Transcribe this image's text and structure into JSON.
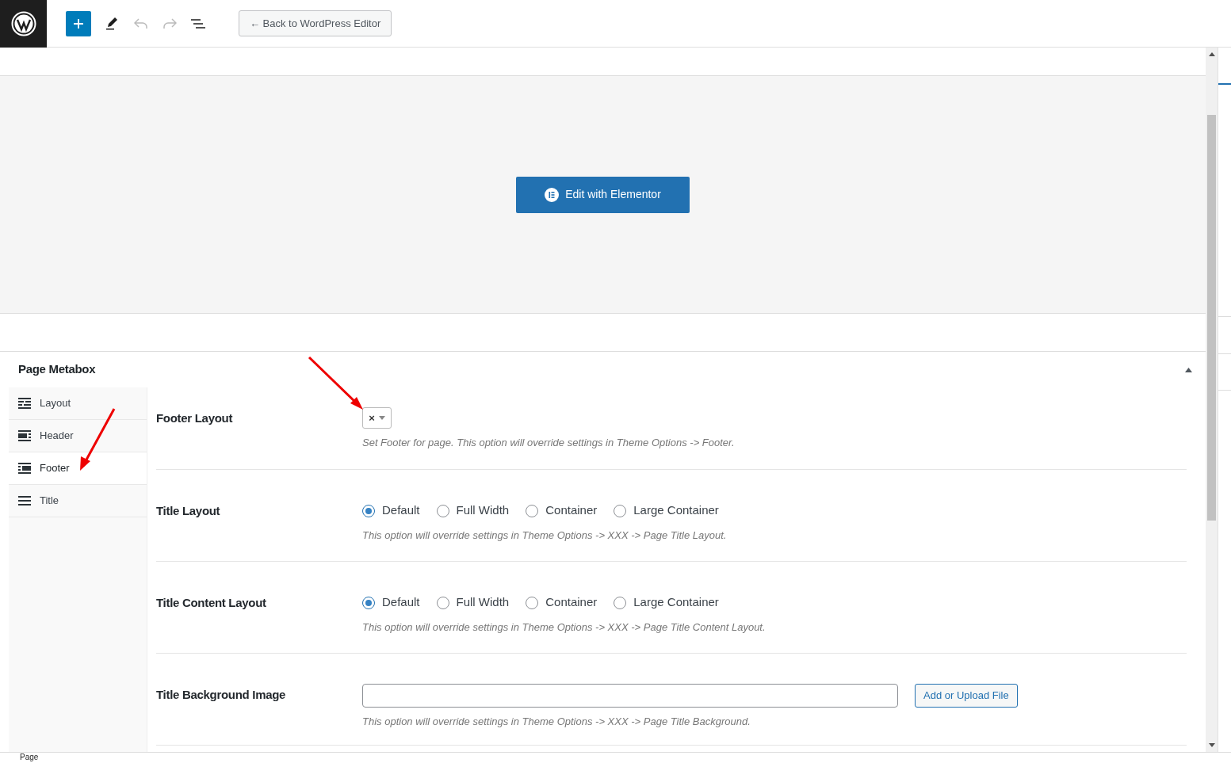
{
  "toolbar": {
    "back_button": "← Back to WordPress Editor",
    "undo_disabled": true,
    "redo_disabled": true
  },
  "canvas": {
    "button": "Edit with Elementor"
  },
  "metabox": {
    "title": "Page Metabox",
    "expanded": true,
    "tabs": [
      {
        "label": "Layout",
        "selected": false
      },
      {
        "label": "Header",
        "selected": false
      },
      {
        "label": "Footer",
        "selected": true
      },
      {
        "label": "Title",
        "selected": false
      }
    ],
    "fields": [
      {
        "kind": "select",
        "label": "Footer Layout",
        "value": "×",
        "help": "Set Footer for page. This option will override settings in Theme Options -> Footer."
      },
      {
        "kind": "radio",
        "label": "Title Layout",
        "options": [
          {
            "label": "Default",
            "selected": true
          },
          {
            "label": "Full Width",
            "selected": false
          },
          {
            "label": "Container",
            "selected": false
          },
          {
            "label": "Large Container",
            "selected": false
          }
        ],
        "help": "This option will override settings in Theme Options -> XXX -> Page Title Layout."
      },
      {
        "kind": "radio",
        "label": "Title Content Layout",
        "options": [
          {
            "label": "Default",
            "selected": true
          },
          {
            "label": "Full Width",
            "selected": false
          },
          {
            "label": "Container",
            "selected": false
          },
          {
            "label": "Large Container",
            "selected": false
          }
        ],
        "help": "This option will override settings in Theme Options -> XXX -> Page Title Content Layout."
      },
      {
        "kind": "upload",
        "label": "Title Background Image",
        "button": "Add or Upload File",
        "help": "This option will override settings in Theme Options -> XXX -> Page Title Background."
      }
    ]
  },
  "status_bar": {
    "breadcrumb": "Page"
  }
}
